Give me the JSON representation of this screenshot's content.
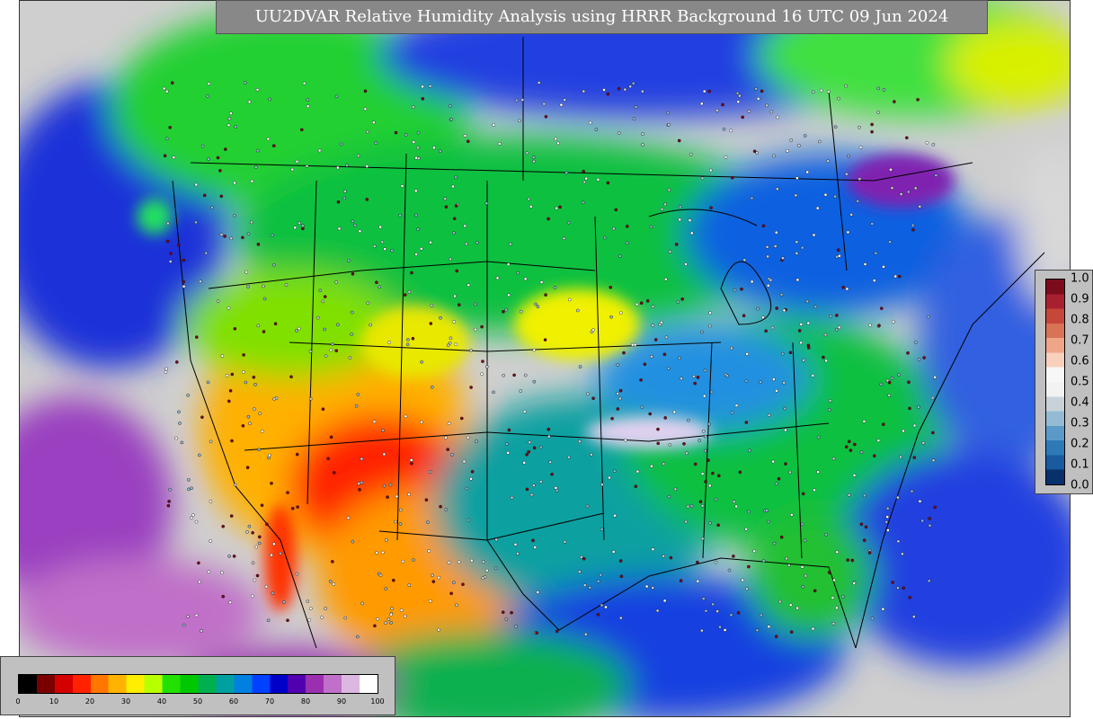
{
  "title": "UU2DVAR Relative Humidity Analysis using HRRR Background 16 UTC 09 Jun 2024",
  "rh_colorbar": {
    "ticks": [
      "0",
      "10",
      "20",
      "30",
      "40",
      "50",
      "60",
      "70",
      "80",
      "90",
      "100"
    ],
    "min": 0,
    "max": 100,
    "colors": [
      "#000000",
      "#7a0000",
      "#d40000",
      "#ff2200",
      "#ff7700",
      "#ffb300",
      "#ffee00",
      "#b8ff00",
      "#22e000",
      "#00c800",
      "#00b050",
      "#00a0a0",
      "#0080e0",
      "#0040ff",
      "#0000c8",
      "#5000b0",
      "#9a30b0",
      "#c070c8",
      "#dcb8e0",
      "#ffffff"
    ]
  },
  "ratio_colorbar": {
    "ticks": [
      "1.0",
      "0.9",
      "0.8",
      "0.7",
      "0.6",
      "0.5",
      "0.4",
      "0.3",
      "0.2",
      "0.1",
      "0.0"
    ],
    "min": 0.0,
    "max": 1.0,
    "colors": [
      "#08306b",
      "#1a5a9e",
      "#2e7ab8",
      "#5b9ac8",
      "#95bad4",
      "#c8d2d8",
      "#f2f2f2",
      "#f7f7f7",
      "#f8d0bc",
      "#eea588",
      "#d97356",
      "#c4473a",
      "#a82030",
      "#7a0c1c"
    ]
  },
  "map_colors": {
    "ocean_gray": "#cfcfcf",
    "borders": "#000000",
    "station_markers": [
      "#ffffff",
      "#7a0c1c",
      "#c8d2d8",
      "#95bad4"
    ]
  }
}
